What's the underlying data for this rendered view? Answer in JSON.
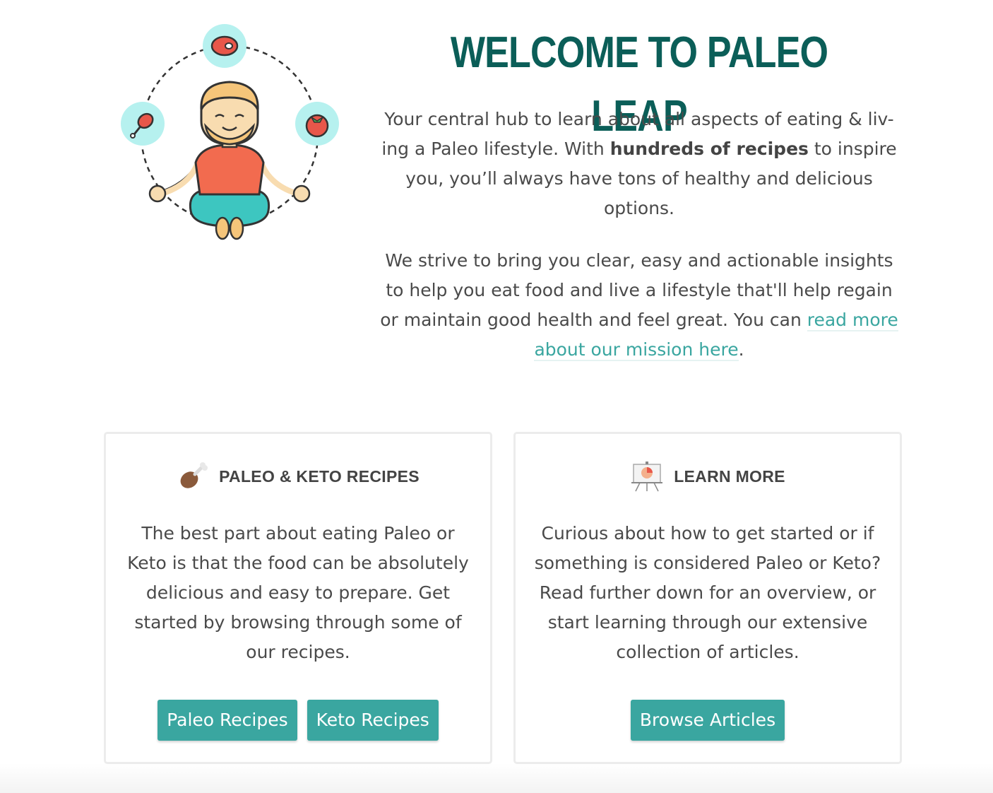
{
  "hero": {
    "title": "WELCOME TO PALEO LEAP",
    "intro_part1": "Your central hub to learn about all aspects of eating & liv-ing a Paleo lifestyle. With ",
    "intro_bold": "hundreds of recipes",
    "intro_part2": " to inspire you, you’ll always have tons of healthy and delicious options.",
    "mission_text": "We strive to bring you clear, easy and actionable insights to help you eat food and live a lifestyle that'll help regain or maintain good health and feel great. You can ",
    "mission_link": "read more about our mission here",
    "mission_end": "."
  },
  "illustration": {
    "icons": [
      "meditating-person-icon",
      "steak-icon",
      "drumstick-icon",
      "tomato-icon"
    ]
  },
  "cards": {
    "recipes": {
      "icon": "drumstick-icon",
      "title": "PALEO & KETO RECIPES",
      "body": "The best part about eating Paleo or Keto is that the food can be absolutely delicious and easy to prepare. Get started by browsing through some of our recipes.",
      "buttons": [
        "Paleo Recipes",
        "Keto Recipes"
      ]
    },
    "learn": {
      "icon": "presentation-chart-icon",
      "title": "LEARN MORE",
      "body": "Curious about how to get started or if something is considered Paleo or Keto? Read further down for an overview, or start learning through our extensive collection of articles.",
      "buttons": [
        "Browse Articles"
      ]
    }
  },
  "colors": {
    "title": "#0b5e58",
    "accent": "#3aa6a0",
    "text": "#4a4a4a",
    "card_border": "#ececec"
  }
}
